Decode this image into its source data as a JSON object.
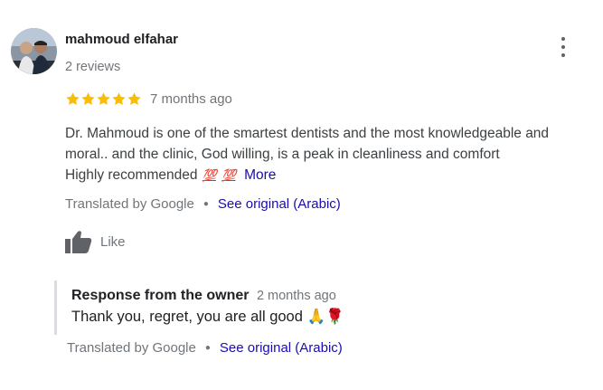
{
  "review": {
    "author": "mahmoud elfahar",
    "reviews_count": "2 reviews",
    "rating": 5,
    "time_ago": "7 months ago",
    "text_line1": "Dr. Mahmoud is one of the smartest dentists and the most knowledgeable and",
    "text_line2": "moral.. and the clinic, God willing, is a peak in cleanliness and comfort",
    "text_line3": "Highly recommended",
    "emoji": "💯",
    "more_label": "More",
    "translated_by": "Translated by Google",
    "see_original": "See original (Arabic)",
    "like_label": "Like",
    "star_color": "#fbbc04"
  },
  "owner_response": {
    "header": "Response from the owner",
    "time_ago": "2 months ago",
    "text": "Thank you, regret, you are all good",
    "emoji": "🙏🌹",
    "translated_by": "Translated by Google",
    "see_original": "See original (Arabic)"
  },
  "icons": [
    "avatar",
    "more-vert-icon",
    "star-icon",
    "thumb-up-icon"
  ],
  "colors": {
    "link": "#1a0dab",
    "muted": "#70757a",
    "text": "#3c4043"
  }
}
